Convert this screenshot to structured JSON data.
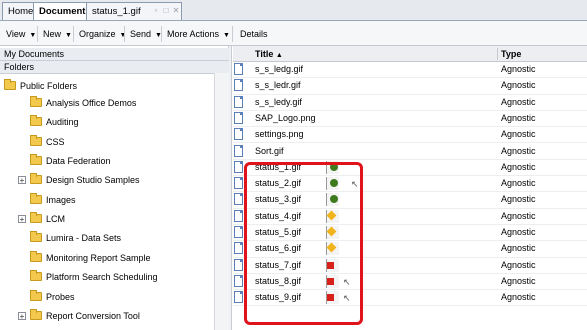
{
  "tabs": [
    {
      "label": "Home"
    },
    {
      "label": "Documents"
    },
    {
      "label": "status_1.gif"
    }
  ],
  "toolbar": {
    "view": "View",
    "new": "New",
    "organize": "Organize",
    "send": "Send",
    "more_actions": "More Actions",
    "details": "Details"
  },
  "left_panel": {
    "my_documents": "My Documents",
    "folders_label": "Folders",
    "root": "Public Folders",
    "folders": [
      {
        "label": "Analysis Office Demos",
        "expandable": false
      },
      {
        "label": "Auditing",
        "expandable": false
      },
      {
        "label": "CSS",
        "expandable": false
      },
      {
        "label": "Data Federation",
        "expandable": false
      },
      {
        "label": "Design Studio Samples",
        "expandable": true
      },
      {
        "label": "Images",
        "expandable": false
      },
      {
        "label": "LCM",
        "expandable": true
      },
      {
        "label": "Lumira - Data Sets",
        "expandable": false
      },
      {
        "label": "Monitoring Report Sample",
        "expandable": false
      },
      {
        "label": "Platform Search Scheduling",
        "expandable": false
      },
      {
        "label": "Probes",
        "expandable": false
      },
      {
        "label": "Report Conversion Tool",
        "expandable": true
      }
    ]
  },
  "table": {
    "col_title": "Title",
    "col_type": "Type",
    "rows": [
      {
        "title": "s_s_ledg.gif",
        "type": "Agnostic",
        "preview": ""
      },
      {
        "title": "s_s_ledr.gif",
        "type": "Agnostic",
        "preview": ""
      },
      {
        "title": "s_s_ledy.gif",
        "type": "Agnostic",
        "preview": ""
      },
      {
        "title": "SAP_Logo.png",
        "type": "Agnostic",
        "preview": ""
      },
      {
        "title": "settings.png",
        "type": "Agnostic",
        "preview": ""
      },
      {
        "title": "Sort.gif",
        "type": "Agnostic",
        "preview": ""
      },
      {
        "title": "status_1.gif",
        "type": "Agnostic",
        "preview": "green"
      },
      {
        "title": "status_2.gif",
        "type": "Agnostic",
        "preview": "green"
      },
      {
        "title": "status_3.gif",
        "type": "Agnostic",
        "preview": "green"
      },
      {
        "title": "status_4.gif",
        "type": "Agnostic",
        "preview": "yellow"
      },
      {
        "title": "status_5.gif",
        "type": "Agnostic",
        "preview": "yellow"
      },
      {
        "title": "status_6.gif",
        "type": "Agnostic",
        "preview": "yellow"
      },
      {
        "title": "status_7.gif",
        "type": "Agnostic",
        "preview": "red"
      },
      {
        "title": "status_8.gif",
        "type": "Agnostic",
        "preview": "red"
      },
      {
        "title": "status_9.gif",
        "type": "Agnostic",
        "preview": "red"
      }
    ]
  },
  "colors": {
    "highlight": "#e0121a",
    "status_green": "#3f7a1f",
    "status_yellow": "#f0b41c",
    "status_red": "#d7211b",
    "folder": "#f2c94c"
  }
}
